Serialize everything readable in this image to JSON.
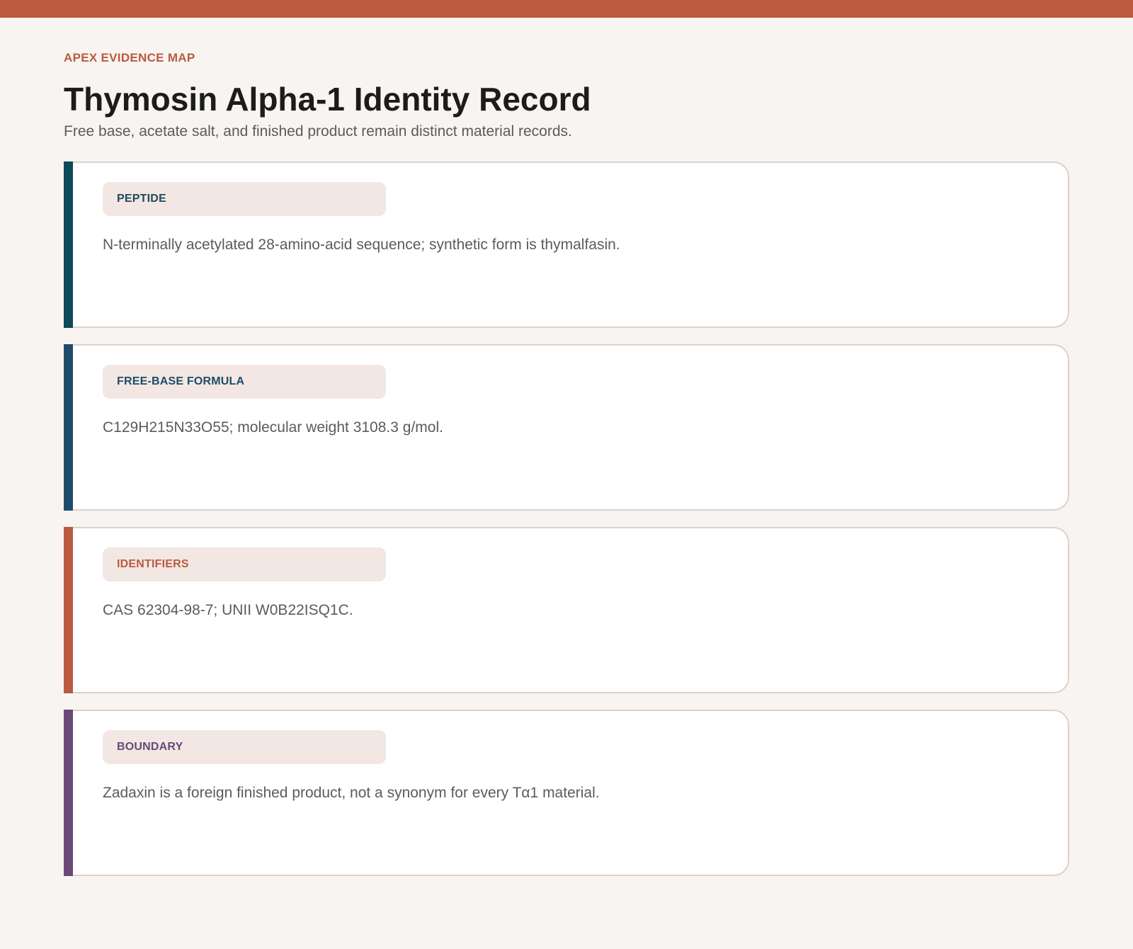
{
  "header": {
    "eyebrow": "APEX EVIDENCE MAP",
    "title": "Thymosin Alpha-1 Identity Record",
    "subtitle": "Free base, acetate salt, and finished product remain distinct material records."
  },
  "colors": {
    "top_bar": "#b95a41",
    "background": "#f8f4f1"
  },
  "cards": [
    {
      "label": "PEPTIDE",
      "text": "N-terminally acetylated 28-amino-acid sequence; synthetic form is thymalfasin.",
      "accent": "#0f4a5a",
      "label_color": "#1f4b5c"
    },
    {
      "label": "FREE-BASE FORMULA",
      "text": "C129H215N33O55; molecular weight 3108.3 g/mol.",
      "accent": "#1f4b6b",
      "label_color": "#1f4b6b"
    },
    {
      "label": "IDENTIFIERS",
      "text": "CAS 62304-98-7; UNII W0B22ISQ1C.",
      "accent": "#b95a41",
      "label_color": "#b95a41"
    },
    {
      "label": "BOUNDARY",
      "text": "Zadaxin is a foreign finished product, not a synonym for every Tα1 material.",
      "accent": "#6a4878",
      "label_color": "#6a4878"
    }
  ]
}
